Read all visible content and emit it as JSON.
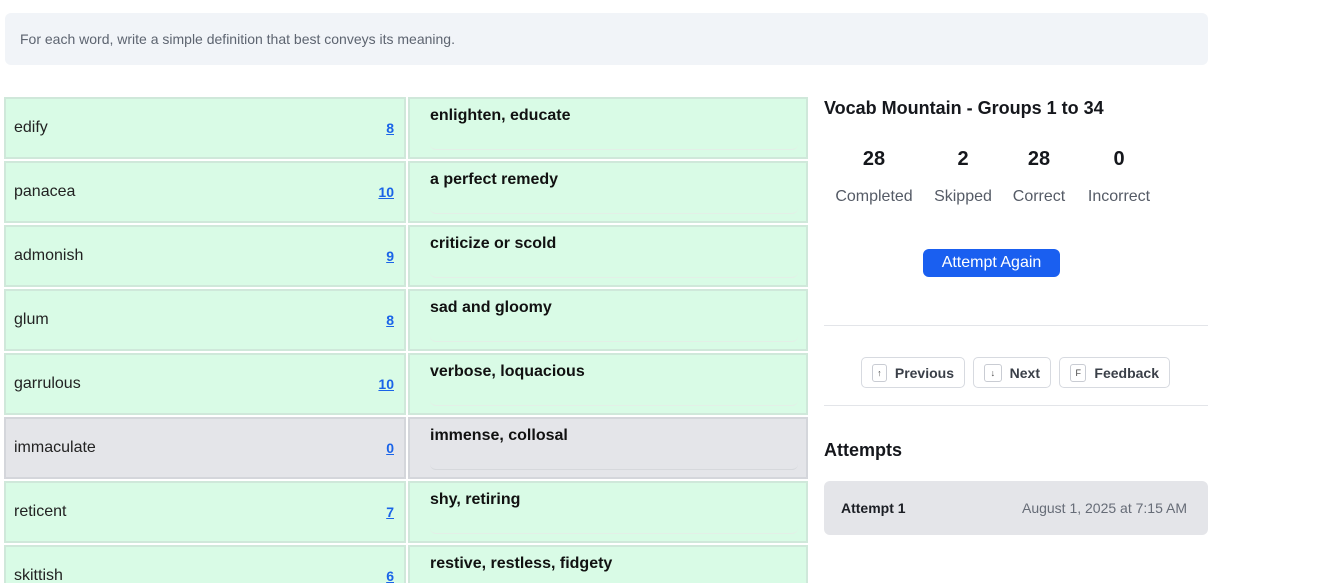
{
  "instructions": "For each word, write a simple definition that best conveys its meaning.",
  "rows": [
    {
      "word": "edify",
      "count": "8",
      "definition": "enlighten, educate",
      "status": "correct"
    },
    {
      "word": "panacea",
      "count": "10",
      "definition": "a perfect remedy",
      "status": "correct"
    },
    {
      "word": "admonish",
      "count": "9",
      "definition": "criticize or scold",
      "status": "correct"
    },
    {
      "word": "glum",
      "count": "8",
      "definition": "sad and gloomy",
      "status": "correct"
    },
    {
      "word": "garrulous",
      "count": "10",
      "definition": "verbose, loquacious",
      "status": "correct"
    },
    {
      "word": "immaculate",
      "count": "0",
      "definition": "immense, collosal",
      "status": "skipped"
    },
    {
      "word": "reticent",
      "count": "7",
      "definition": "shy, retiring",
      "status": "correct"
    },
    {
      "word": "skittish",
      "count": "6",
      "definition": "restive, restless, fidgety",
      "status": "correct"
    }
  ],
  "panel": {
    "title": "Vocab Mountain - Groups 1 to 34",
    "stats": [
      {
        "value": "28",
        "label": "Completed"
      },
      {
        "value": "2",
        "label": "Skipped"
      },
      {
        "value": "28",
        "label": "Correct"
      },
      {
        "value": "0",
        "label": "Incorrect"
      }
    ],
    "attempt_again_label": "Attempt Again"
  },
  "nav": {
    "previous": {
      "key": "↑",
      "label": "Previous"
    },
    "next": {
      "key": "↓",
      "label": "Next"
    },
    "feedback": {
      "key": "F",
      "label": "Feedback"
    }
  },
  "attempts": {
    "heading": "Attempts",
    "items": [
      {
        "name": "Attempt 1",
        "date": "August 1, 2025 at 7:15 AM"
      }
    ]
  },
  "colors": {
    "correct": "#d9fbe6",
    "skipped": "#e4e5e9",
    "accent": "#1a5ff0",
    "link": "#1a64e8"
  }
}
